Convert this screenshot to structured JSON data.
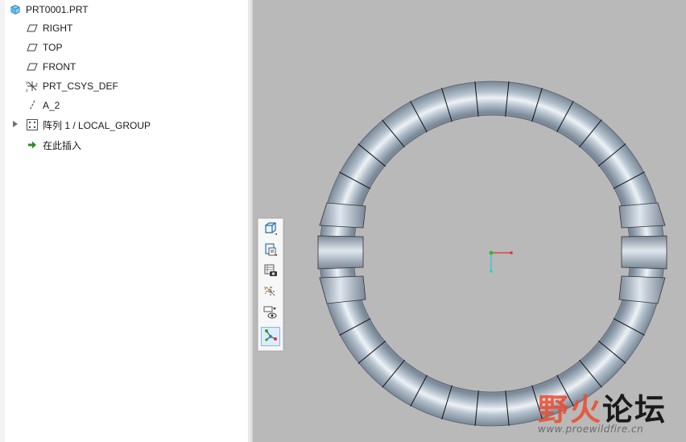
{
  "model_tree": {
    "items": [
      {
        "label": "PRT0001.PRT",
        "icon": "part-icon"
      },
      {
        "label": "RIGHT",
        "icon": "datum-plane-icon"
      },
      {
        "label": "TOP",
        "icon": "datum-plane-icon"
      },
      {
        "label": "FRONT",
        "icon": "datum-plane-icon"
      },
      {
        "label": "PRT_CSYS_DEF",
        "icon": "coordinate-system-icon"
      },
      {
        "label": "A_2",
        "icon": "datum-axis-icon"
      },
      {
        "label": "阵列 1 / LOCAL_GROUP",
        "icon": "pattern-icon",
        "expandable": true
      },
      {
        "label": "在此插入",
        "icon": "insert-here-arrow-icon"
      }
    ]
  },
  "view_toolbar": {
    "buttons": [
      {
        "name": "saved-orientations-button",
        "icon": "cube-view-icon"
      },
      {
        "name": "saved-views-button",
        "icon": "view-manager-icon"
      },
      {
        "name": "appearance-button",
        "icon": "camera-display-icon"
      },
      {
        "name": "datum-display-button",
        "icon": "datum-display-icon"
      },
      {
        "name": "visibility-button",
        "icon": "eye-filter-icon"
      },
      {
        "name": "annotation-display-button",
        "icon": "node-network-icon",
        "active": true
      }
    ]
  },
  "colors": {
    "viewport_bg": "#b9b9b9",
    "model_fill": "#a9b6c4",
    "model_highlight": "#e9eef3",
    "model_shadow": "#7a8796",
    "csys_x": "#e03030",
    "csys_y": "#2dbb2d",
    "csys_z": "#22c8d8"
  },
  "watermark": {
    "text_accent": "野火",
    "text_main": "论坛",
    "url": "www.proewildfire.cn"
  }
}
